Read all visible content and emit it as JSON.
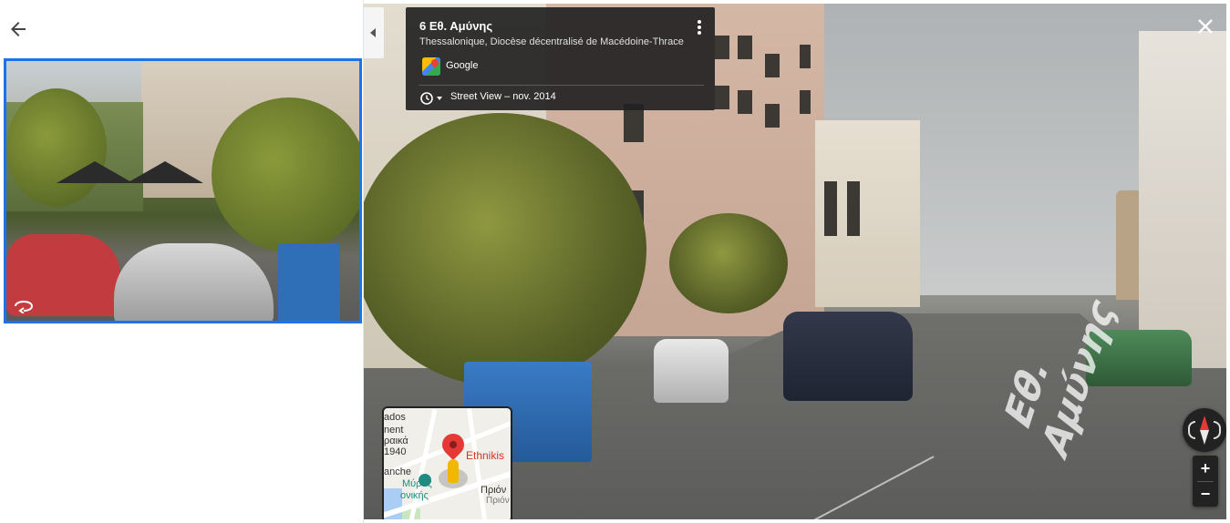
{
  "left_panel": {
    "back_label": "←"
  },
  "info_card": {
    "title": "6 Εθ. Αμύνης",
    "subtitle": "Thessalonique, Diocèse décentralisé de Macédoine-Thrace",
    "source": "Google",
    "history": "Street View – nov. 2014"
  },
  "controls": {
    "close": "✕",
    "zoom_in": "+",
    "zoom_out": "−"
  },
  "scene": {
    "road_marking": "Εθ. Αμύνης"
  },
  "minimap": {
    "labels": [
      "ados",
      "nent",
      "ραικά",
      "1940",
      "anche",
      "Μύρος",
      "ονικής",
      "Ethnikis",
      "Πριόν",
      "Πριόν"
    ]
  },
  "colors": {
    "accent": "#1a73e8",
    "card_bg": "#222222",
    "pin": "#e53935"
  }
}
